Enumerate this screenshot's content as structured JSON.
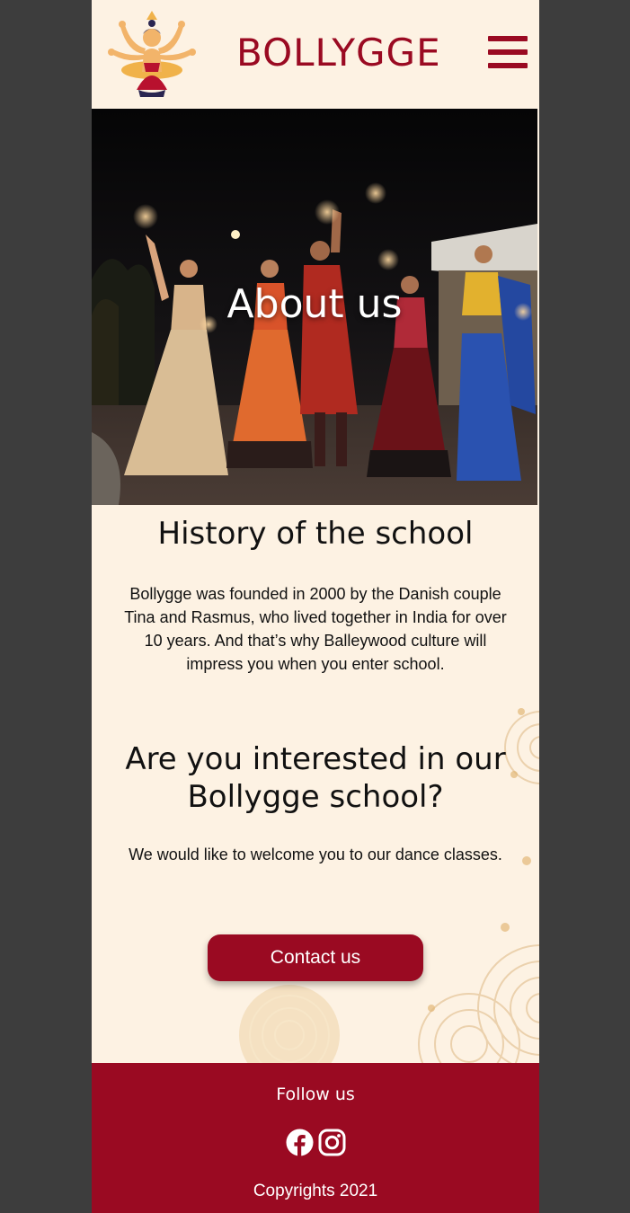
{
  "header": {
    "brand": "BOLLYGGE",
    "logo_icon": "dancer-logo-icon",
    "menu_icon": "hamburger-menu-icon"
  },
  "hero": {
    "title": "About us"
  },
  "history": {
    "heading": "History of the school",
    "body": "Bollygge was founded in 2000 by the Danish couple Tina and Rasmus, who lived together in India for over 10 years. And that’s why Balleywood culture will impress you when you enter school."
  },
  "interest": {
    "heading": "Are you interested in our Bollygge school?",
    "body": "We would like to welcome you to our dance classes.",
    "button_label": "Contact us"
  },
  "footer": {
    "follow_label": "Follow us",
    "social_icons": [
      "facebook-icon",
      "instagram-icon"
    ],
    "copyright": "Copyrights 2021"
  },
  "colors": {
    "brand": "#9a0a22",
    "page_background": "#fdf2e3",
    "outer_background": "#3d3d3d",
    "text": "#111111"
  }
}
